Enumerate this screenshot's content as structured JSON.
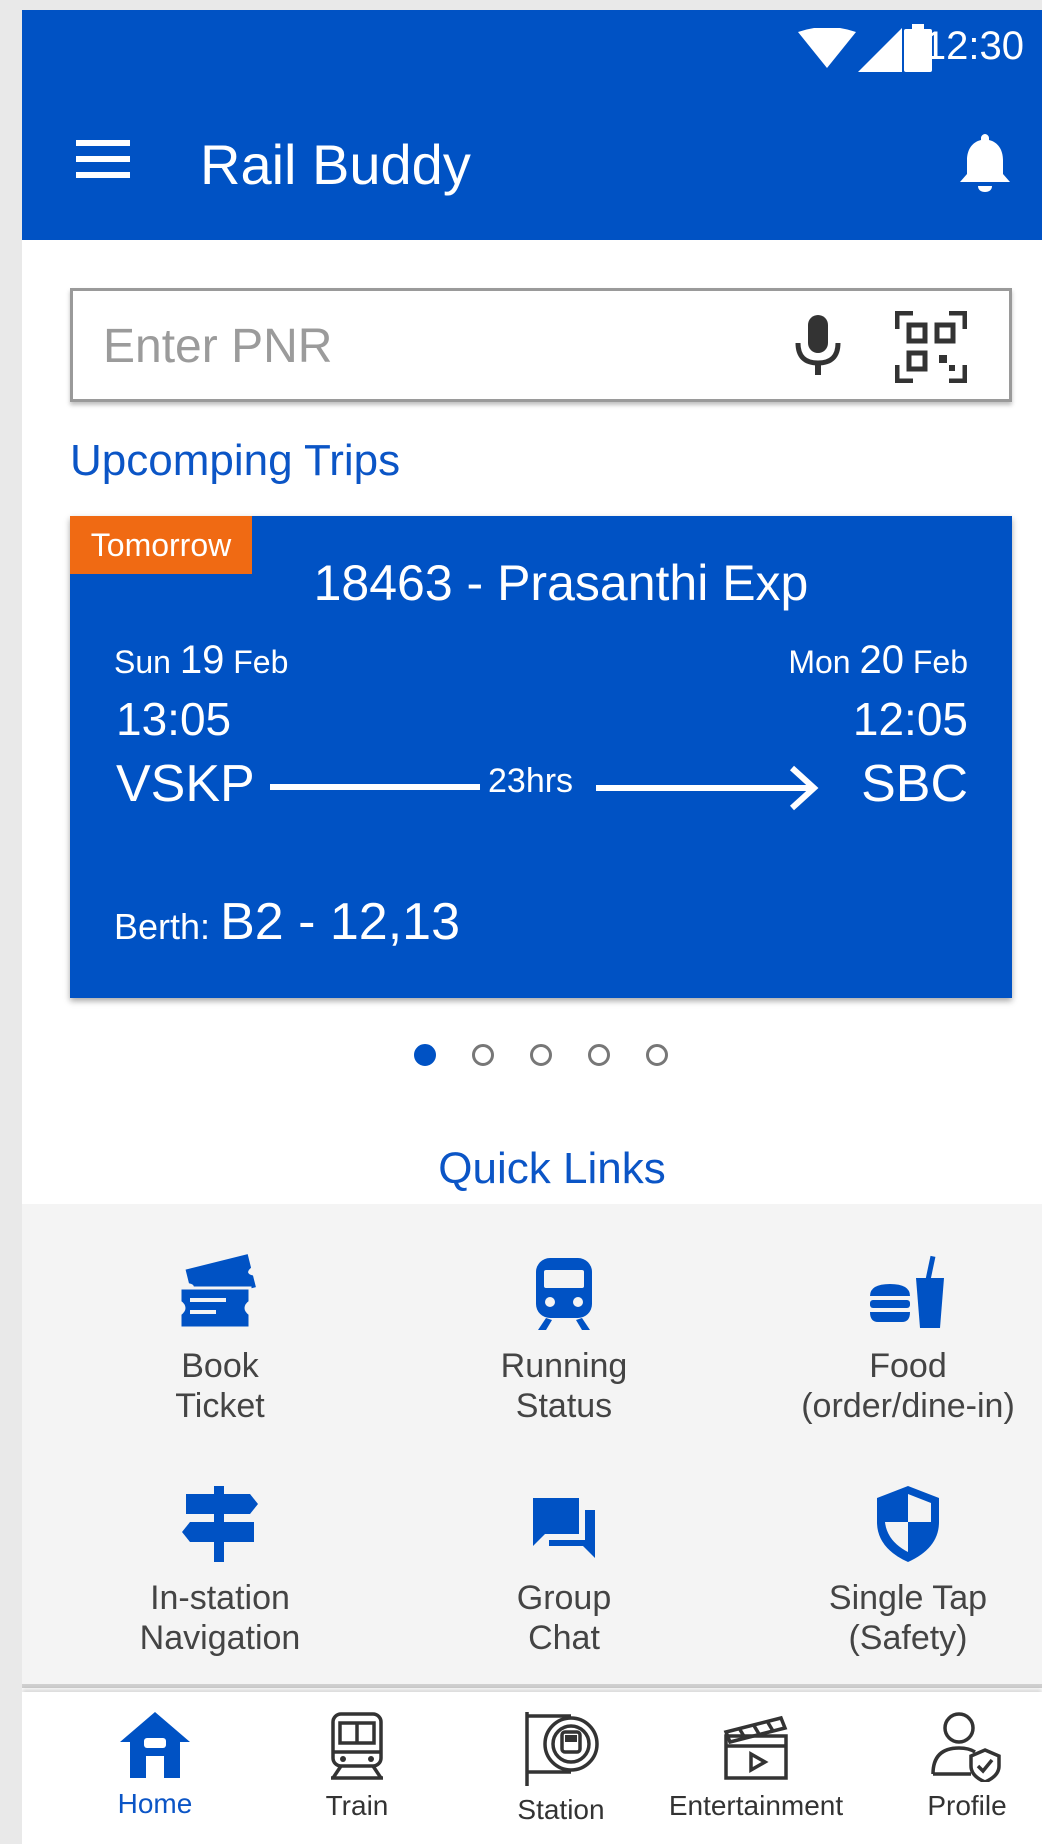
{
  "status_bar": {
    "time": "12:30"
  },
  "app_bar": {
    "title": "Rail Buddy"
  },
  "search": {
    "placeholder": "Enter PNR",
    "value": ""
  },
  "upcoming": {
    "title": "Upcomping Trips",
    "trip": {
      "badge": "Tomorrow",
      "train": "18463 - Prasanthi Exp",
      "departure": {
        "day": "Sun",
        "date": "19",
        "month": "Feb",
        "time": "13:05",
        "station": "VSKP"
      },
      "arrival": {
        "day": "Mon",
        "date": "20",
        "month": "Feb",
        "time": "12:05",
        "station": "SBC"
      },
      "duration": "23hrs",
      "berth_label": "Berth:",
      "berth_value": "B2 - 12,13"
    },
    "pager": {
      "count": 5,
      "active_index": 0
    }
  },
  "quick_links": {
    "title": "Quick Links",
    "items": [
      {
        "label": "Book\nTicket",
        "icon": "tickets-icon"
      },
      {
        "label": "Running\nStatus",
        "icon": "train-front-icon"
      },
      {
        "label": "Food\n(order/dine-in)",
        "icon": "food-icon"
      },
      {
        "label": "In-station\nNavigation",
        "icon": "signpost-icon"
      },
      {
        "label": "Group\nChat",
        "icon": "chat-icon"
      },
      {
        "label": "Single Tap\n(Safety)",
        "icon": "shield-icon"
      }
    ]
  },
  "bottom_nav": {
    "items": [
      {
        "label": "Home",
        "icon": "home-icon",
        "active": true
      },
      {
        "label": "Train",
        "icon": "train-icon",
        "active": false
      },
      {
        "label": "Station",
        "icon": "station-icon",
        "active": false
      },
      {
        "label": "Entertainment",
        "icon": "clapperboard-icon",
        "active": false
      },
      {
        "label": "Profile",
        "icon": "profile-shield-icon",
        "active": false
      }
    ]
  },
  "colors": {
    "primary": "#0052c4",
    "accent": "#f06a13",
    "link": "#0b55c6"
  }
}
